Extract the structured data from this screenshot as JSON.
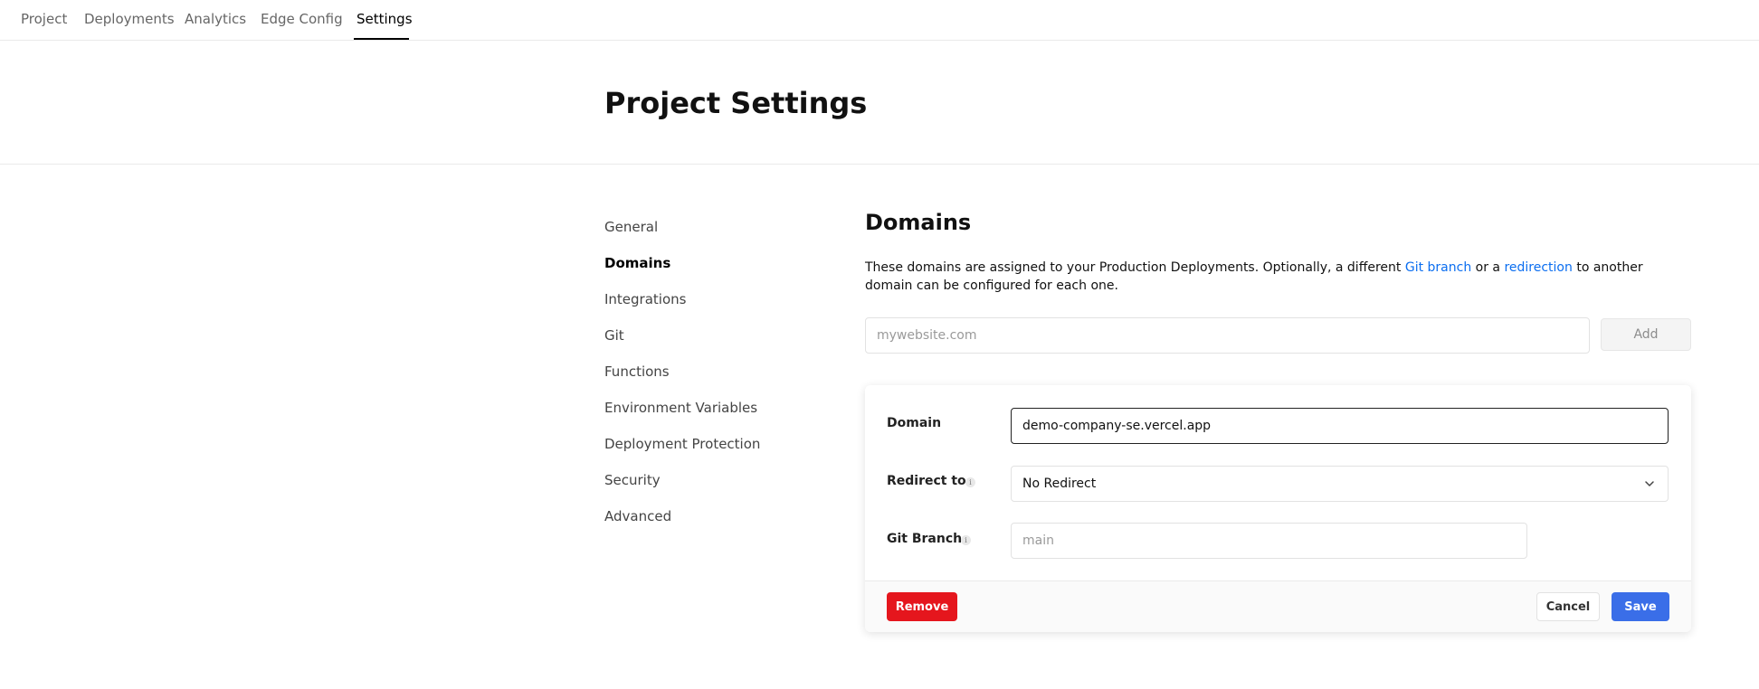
{
  "topnav": {
    "tabs": [
      {
        "label": "Project"
      },
      {
        "label": "Deployments"
      },
      {
        "label": "Analytics"
      },
      {
        "label": "Edge Config"
      },
      {
        "label": "Settings"
      }
    ],
    "active_tab": "Settings"
  },
  "header": {
    "title": "Project Settings"
  },
  "sidebar": {
    "items": [
      {
        "label": "General"
      },
      {
        "label": "Domains"
      },
      {
        "label": "Integrations"
      },
      {
        "label": "Git"
      },
      {
        "label": "Functions"
      },
      {
        "label": "Environment Variables"
      },
      {
        "label": "Deployment Protection"
      },
      {
        "label": "Security"
      },
      {
        "label": "Advanced"
      }
    ],
    "active_item": "Domains"
  },
  "domains": {
    "title": "Domains",
    "description_part1": "These domains are assigned to your Production Deployments. Optionally, a different ",
    "link_git_branch": "Git branch",
    "description_part2": " or a ",
    "link_redirection": "redirection",
    "description_part3": " to another domain can be configured for each one.",
    "add_input_placeholder": "mywebsite.com",
    "add_button_label": "Add"
  },
  "domain_card": {
    "domain_label": "Domain",
    "domain_value": "demo-company-se.vercel.app",
    "redirect_label": "Redirect to",
    "redirect_value": "No Redirect",
    "git_branch_label": "Git Branch",
    "git_branch_placeholder": "main",
    "remove_label": "Remove",
    "cancel_label": "Cancel",
    "save_label": "Save"
  },
  "colors": {
    "link": "#0b6ef0",
    "remove_button": "#e5161d",
    "save_button": "#3a6ee8"
  },
  "icons": {
    "info": "info-icon",
    "dropdown": "chevron-down-icon"
  }
}
